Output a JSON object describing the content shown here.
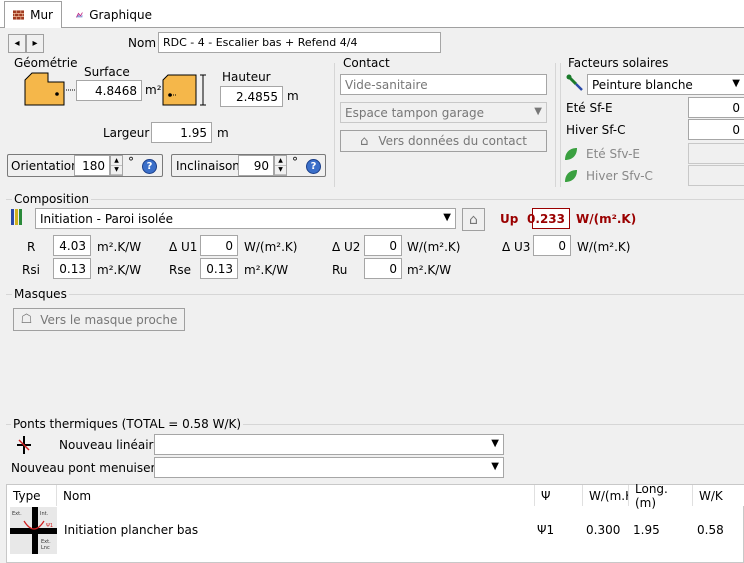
{
  "tabs": [
    {
      "label": "Mur",
      "active": true
    },
    {
      "label": "Graphique",
      "active": false
    }
  ],
  "nav": {
    "prev": "◂",
    "next": "▸"
  },
  "nom": {
    "label": "Nom",
    "value": "RDC - 4 - Escalier bas + Refend 4/4"
  },
  "geometrie": {
    "title": "Géométrie",
    "surface_label": "Surface",
    "surface_value": "4.8468",
    "surface_unit": "m²",
    "hauteur_label": "Hauteur",
    "hauteur_value": "2.4855",
    "hauteur_unit": "m",
    "largeur_label": "Largeur",
    "largeur_value": "1.95",
    "largeur_unit": "m",
    "orientation_label": "Orientation",
    "orientation_value": "180",
    "inclinaison_label": "Inclinaison",
    "inclinaison_value": "90",
    "deg": "°"
  },
  "contact": {
    "title": "Contact",
    "field1": "Vide-sanitaire",
    "field2": "Espace tampon garage",
    "button": "Vers données du contact"
  },
  "facteurs": {
    "title": "Facteurs solaires",
    "combo": "Peinture blanche",
    "ete_sfe_label": "Eté Sf-E",
    "ete_sfe_value": "0",
    "hiver_sfc_label": "Hiver Sf-C",
    "hiver_sfc_value": "0",
    "ete_sfve_label": "Eté Sfv-E",
    "hiver_sfvc_label": "Hiver Sfv-C"
  },
  "composition": {
    "title": "Composition",
    "combo": "Initiation - Paroi isolée",
    "up_label": "Up",
    "up_value": "0.233",
    "up_unit": "W/(m².K)",
    "r_label": "R",
    "r_value": "4.03",
    "r_unit": "m².K/W",
    "du1_label": "Δ U1",
    "du1_value": "0",
    "du1_unit": "W/(m².K)",
    "du2_label": "Δ U2",
    "du2_value": "0",
    "du2_unit": "W/(m².K)",
    "du3_label": "Δ U3",
    "du3_value": "0",
    "du3_unit": "W/(m².K)",
    "rsi_label": "Rsi",
    "rsi_value": "0.13",
    "rsi_unit": "m².K/W",
    "rse_label": "Rse",
    "rse_value": "0.13",
    "rse_unit": "m².K/W",
    "ru_label": "Ru",
    "ru_value": "0",
    "ru_unit": "m².K/W"
  },
  "masques": {
    "title": "Masques",
    "button": "Vers le masque proche"
  },
  "ponts": {
    "title": "Ponts thermiques (TOTAL = 0.58 W/K)",
    "nouveau_lineaire": "Nouveau linéaire",
    "nouveau_menuiserie": "Nouveau pont menuiserie"
  },
  "table": {
    "columns": [
      "Type",
      "Nom",
      "Ψ",
      "W/(m.K",
      "Long. (m)",
      "W/K"
    ],
    "rows": [
      {
        "nom": "Initiation plancher bas",
        "psi": "Ψ1",
        "w": "0.300",
        "long": "1.95",
        "wk": "0.58"
      }
    ],
    "icon_text": [
      "Ext.",
      "Int.",
      "Ψ1",
      "Ext.",
      "Lnc"
    ]
  },
  "colors": {
    "up_red": "#9a0000",
    "help_blue": "#3b6fc9"
  }
}
